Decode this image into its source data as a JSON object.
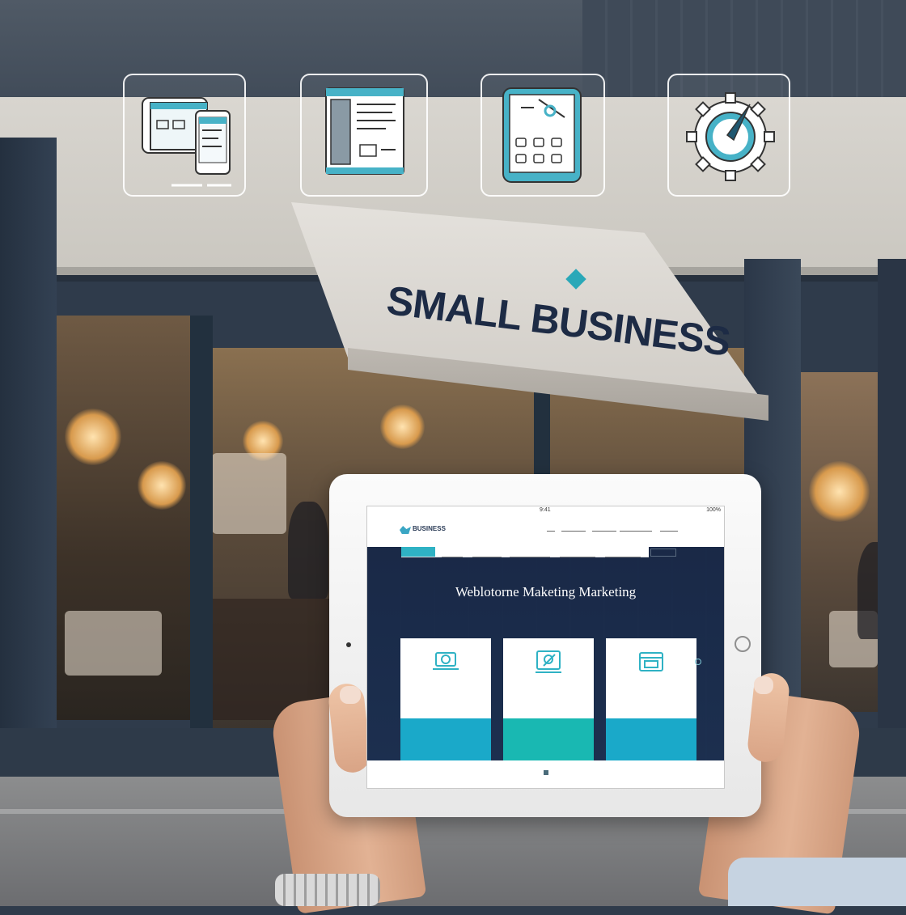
{
  "storefront": {
    "sign_text": "SMALL BUSINESS"
  },
  "icons": [
    {
      "name": "responsive-devices-icon"
    },
    {
      "name": "web-page-layout-icon"
    },
    {
      "name": "tablet-apps-icon"
    },
    {
      "name": "gear-compass-icon"
    }
  ],
  "tablet": {
    "status_time": "9:41",
    "status_right": "100%",
    "site": {
      "logo": "BUSINESS",
      "hero_title": "Weblotorne Maketing Marketing",
      "cards": [
        {
          "icon": "laptop-icon",
          "band_color": "#1aa9c9"
        },
        {
          "icon": "tools-icon",
          "band_color": "#19b8b2"
        },
        {
          "icon": "browser-icon",
          "band_color": "#1aa9c9"
        }
      ]
    }
  },
  "colors": {
    "accent": "#2fb2c4",
    "navy": "#1d2b45"
  }
}
